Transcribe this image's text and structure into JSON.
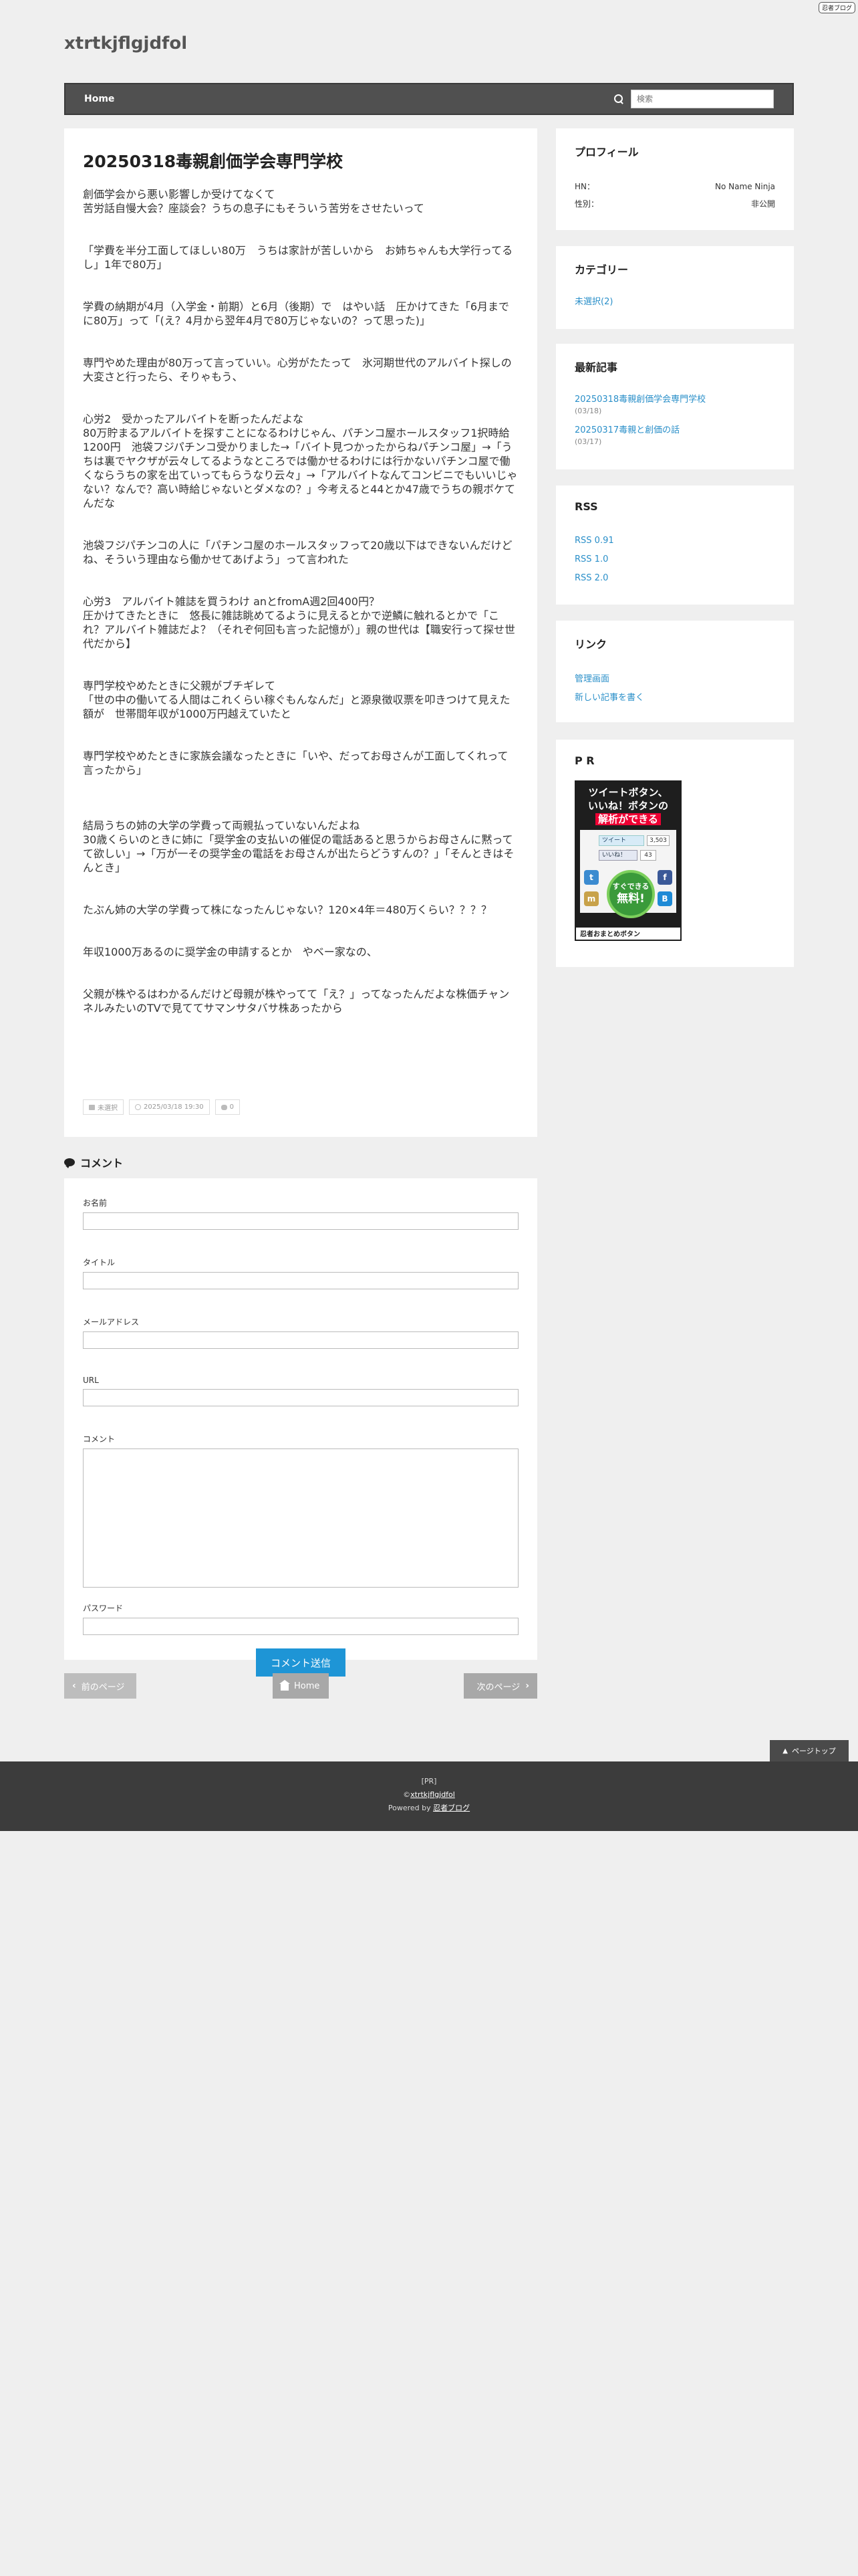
{
  "header": {
    "badge": "忍者ブログ",
    "site_title": "xtrtkjflgjdfol"
  },
  "nav": {
    "home": "Home",
    "search_placeholder": "検索"
  },
  "post": {
    "title": "20250318毒親創価学会専門学校",
    "paragraphs": [
      "創価学会から悪い影響しか受けてなくて\n苦労話自慢大会？座談会？うちの息子にもそういう苦労をさせたいって",
      "「学費を半分工面してほしい80万　うちは家計が苦しいから　お姉ちゃんも大学行ってるし」1年で80万」",
      "学費の納期が4月（入学金・前期）と6月（後期）で　はやい話　圧かけてきた「6月までに80万」って「(え？4月から翌年4月で80万じゃないの？って思った)」",
      "専門やめた理由が80万って言っていい。心労がたたって　氷河期世代のアルバイト探しの大変さと行ったら、そりゃもう、",
      "心労2　受かったアルバイトを断ったんだよな\n80万貯まるアルバイトを探すことになるわけじゃん、パチンコ屋ホールスタッフ1択時給1200円　池袋フジパチンコ受かりました→「バイト見つかったからねパチンコ屋」→「うちは裏でヤクザが云々してるようなところでは働かせるわけには行かないパチンコ屋で働くならうちの家を出ていってもらうなり云々」→「アルバイトなんてコンビニでもいいじゃない？なんで？高い時給じゃないとダメなの？」今考えると44とか47歳でうちの親ボケてんだな",
      "池袋フジパチンコの人に「パチンコ屋のホールスタッフって20歳以下はできないんだけどね、そういう理由なら働かせてあげよう」って言われた",
      "心労3　アルバイト雑誌を買うわけ anとfromA週2回400円？\n圧かけてきたときに　悠長に雑誌眺めてるように見えるとかで逆鱗に触れるとかで「これ？アルバイト雑誌だよ？（それぞ何回も言った記憶が）」親の世代は【職安行って探せ世代だから】",
      "専門学校やめたときに父親がブチギレて\n「世の中の働いてる人間はこれくらい稼ぐもんなんだ」と源泉徴収票を叩きつけて見えた額が　世帯間年収が1000万円越えていたと",
      "専門学校やめたときに家族会議なったときに「いや、だってお母さんが工面してくれって言ったから」",
      "結局うちの姉の大学の学費って両親払っていないんだよね\n30歳くらいのときに姉に「奨学金の支払いの催促の電話あると思うからお母さんに黙ってて欲しい」→「万が一その奨学金の電話をお母さんが出たらどうすんの？」「そんときはそんとき」",
      "たぶん姉の大学の学費って株になったんじゃない？120×4年＝480万くらい？？？？",
      "年収1000万あるのに奨学金の申請するとか　やベー家なの、",
      "父親が株やるはわかるんだけど母親が株やってて「え？」ってなったんだよな株価チャンネルみたいのTVで見ててサマンサタバサ株あったから"
    ],
    "meta": {
      "category": "未選択",
      "date": "2025/03/18 19:30",
      "comments": "0"
    }
  },
  "comment_form": {
    "heading": "コメント",
    "name_label": "お名前",
    "title_label": "タイトル",
    "email_label": "メールアドレス",
    "url_label": "URL",
    "comment_label": "コメント",
    "password_label": "パスワード",
    "submit": "コメント送信"
  },
  "pager": {
    "prev": "前のページ",
    "home": "Home",
    "next": "次のページ"
  },
  "sidebar": {
    "profile": {
      "title": "プロフィール",
      "hn_label": "HN：",
      "hn_value": "No Name Ninja",
      "gender_label": "性別：",
      "gender_value": "非公開"
    },
    "categories": {
      "title": "カテゴリー",
      "items": [
        "未選択(2)"
      ]
    },
    "recent": {
      "title": "最新記事",
      "items": [
        {
          "title": "20250318毒親創価学会専門学校",
          "date": "(03/18)"
        },
        {
          "title": "20250317毒親と創価の話",
          "date": "(03/17)"
        }
      ]
    },
    "rss": {
      "title": "RSS",
      "items": [
        "RSS 0.91",
        "RSS 1.0",
        "RSS 2.0"
      ]
    },
    "links": {
      "title": "リンク",
      "items": [
        "管理画面",
        "新しい記事を書く"
      ]
    },
    "pr": {
      "title": "P R",
      "banner_line1": "ツイートボタン、",
      "banner_line2": "いいね！ボタンの",
      "banner_line3": "解析ができる",
      "tweet": "ツイート",
      "tweet_count": "3,503",
      "like": "いいね！",
      "like_count": "43",
      "circle_top": "すぐできる",
      "circle_free": "無料!",
      "strip": "忍者おまとめボタン"
    }
  },
  "pagetop": "ページトップ",
  "footer": {
    "pr": "[PR]",
    "copyright_prefix": "©",
    "copyright_link": "xtrtkjflgjdfol",
    "powered_prefix": "Powered by",
    "powered_link": "忍者ブログ"
  }
}
